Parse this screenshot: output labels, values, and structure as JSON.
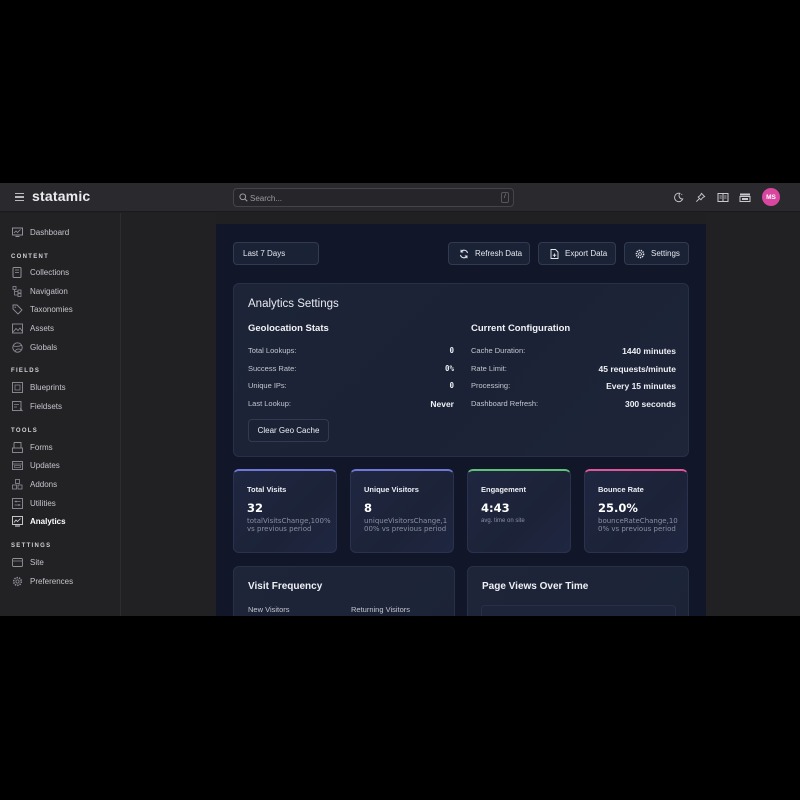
{
  "topbar": {
    "brand": "statamic",
    "search_placeholder": "Search...",
    "search_shortcut": "/",
    "icons": [
      "theme-toggle-icon",
      "pin-icon",
      "docs-book-icon",
      "site-switcher-icon"
    ],
    "avatar_initials": "MS",
    "avatar_color": "#d946a0"
  },
  "sidebar": {
    "dashboard": "Dashboard",
    "sections": [
      {
        "title": "CONTENT",
        "items": [
          "Collections",
          "Navigation",
          "Taxonomies",
          "Assets",
          "Globals"
        ]
      },
      {
        "title": "FIELDS",
        "items": [
          "Blueprints",
          "Fieldsets"
        ]
      },
      {
        "title": "TOOLS",
        "items": [
          "Forms",
          "Updates",
          "Addons",
          "Utilities",
          "Analytics"
        ]
      },
      {
        "title": "SETTINGS",
        "items": [
          "Site",
          "Preferences"
        ]
      }
    ],
    "active_item": "Analytics"
  },
  "toolbar": {
    "period": "Last 7 Days",
    "refresh_label": "Refresh Data",
    "export_label": "Export Data",
    "settings_label": "Settings"
  },
  "analytics_settings": {
    "title": "Analytics Settings",
    "geo": {
      "title": "Geolocation Stats",
      "rows": [
        {
          "label": "Total Lookups:",
          "value": "0"
        },
        {
          "label": "Success Rate:",
          "value": "0%"
        },
        {
          "label": "Unique IPs:",
          "value": "0"
        },
        {
          "label": "Last Lookup:",
          "value": "Never"
        }
      ],
      "clear_button": "Clear Geo Cache"
    },
    "config": {
      "title": "Current Configuration",
      "rows": [
        {
          "label": "Cache Duration:",
          "value": "1440 minutes"
        },
        {
          "label": "Rate Limit:",
          "value": "45 requests/minute"
        },
        {
          "label": "Processing:",
          "value": "Every 15 minutes"
        },
        {
          "label": "Dashboard Refresh:",
          "value": "300 seconds"
        }
      ]
    }
  },
  "stats": [
    {
      "label": "Total Visits",
      "value": "32",
      "sub": "totalVisitsChange,100% vs previous period",
      "accent": "#7078d6"
    },
    {
      "label": "Unique Visitors",
      "value": "8",
      "sub": "uniqueVisitorsChange,100% vs previous period",
      "accent": "#7078d6"
    },
    {
      "label": "Engagement",
      "value": "4:43",
      "sub": "avg. time on site",
      "accent": "#5fc07a"
    },
    {
      "label": "Bounce Rate",
      "value": "25.0%",
      "sub": "bounceRateChange,100% vs previous period",
      "accent": "#e0559b"
    }
  ],
  "visit_frequency": {
    "title": "Visit Frequency",
    "columns": [
      "New Visitors",
      "Returning Visitors"
    ]
  },
  "page_views": {
    "title": "Page Views Over Time"
  }
}
